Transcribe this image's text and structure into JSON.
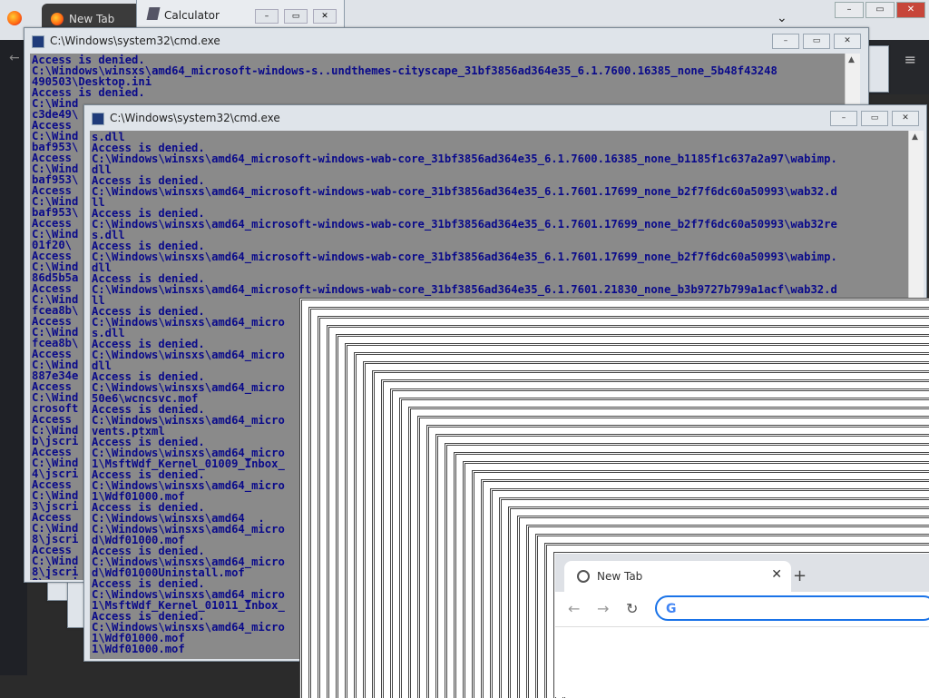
{
  "browser_bg": {
    "tab_label": "New Tab",
    "chevron": "⌄",
    "window_controls": [
      "–",
      "▭",
      "✕"
    ],
    "menu_icon": "≡"
  },
  "calculator": {
    "title": "Calculator",
    "controls": [
      "–",
      "▭",
      "✕"
    ]
  },
  "cmd_back": {
    "title": "C:\\Windows\\system32\\cmd.exe",
    "controls": [
      "–",
      "▭",
      "✕"
    ],
    "lines": [
      "Access is denied.",
      "C:\\Windows\\winsxs\\amd64_microsoft-windows-s..undthemes-cityscape_31bf3856ad364e35_6.1.7600.16385_none_5b48f43248",
      "490503\\Desktop.ini",
      "Access is denied.",
      "C:\\Wind",
      "c3de49\\",
      "Access",
      "C:\\Wind",
      "baf953\\",
      "Access",
      "C:\\Wind",
      "baf953\\",
      "Access",
      "C:\\Wind",
      "baf953\\",
      "Access",
      "C:\\Wind",
      "01f20\\",
      "Access",
      "C:\\Wind",
      "86d5b5a",
      "Access",
      "C:\\Wind",
      "fcea8b\\",
      "Access",
      "C:\\Wind",
      "fcea8b\\",
      "Access",
      "C:\\Wind",
      "887e34e",
      "Access",
      "C:\\Wind",
      "crosoft",
      "Access",
      "C:\\Wind",
      "b\\jscri",
      "Access",
      "C:\\Wind",
      "4\\jscri",
      "Access",
      "C:\\Wind",
      "3\\jscri",
      "Access",
      "C:\\Wind",
      "8\\jscri",
      "Access",
      "C:\\Wind",
      "8\\jscri",
      "8\\jscri"
    ]
  },
  "cmd_front": {
    "title": "C:\\Windows\\system32\\cmd.exe",
    "controls": [
      "–",
      "▭",
      "✕"
    ],
    "lines": [
      "s.dll",
      "Access is denied.",
      "C:\\Windows\\winsxs\\amd64_microsoft-windows-wab-core_31bf3856ad364e35_6.1.7600.16385_none_b1185f1c637a2a97\\wabimp.",
      "dll",
      "Access is denied.",
      "C:\\Windows\\winsxs\\amd64_microsoft-windows-wab-core_31bf3856ad364e35_6.1.7601.17699_none_b2f7f6dc60a50993\\wab32.d",
      "ll",
      "Access is denied.",
      "C:\\Windows\\winsxs\\amd64_microsoft-windows-wab-core_31bf3856ad364e35_6.1.7601.17699_none_b2f7f6dc60a50993\\wab32re",
      "s.dll",
      "Access is denied.",
      "C:\\Windows\\winsxs\\amd64_microsoft-windows-wab-core_31bf3856ad364e35_6.1.7601.17699_none_b2f7f6dc60a50993\\wabimp.",
      "dll",
      "Access is denied.",
      "C:\\Windows\\winsxs\\amd64_microsoft-windows-wab-core_31bf3856ad364e35_6.1.7601.21830_none_b3b9727b799a1acf\\wab32.d",
      "ll",
      "Access is denied.",
      "C:\\Windows\\winsxs\\amd64_micro",
      "s.dll",
      "Access is denied.",
      "C:\\Windows\\winsxs\\amd64_micro",
      "dll",
      "Access is denied.",
      "C:\\Windows\\winsxs\\amd64_micro",
      "50e6\\wcncsvc.mof",
      "Access is denied.",
      "C:\\Windows\\winsxs\\amd64_micro",
      "vents.ptxml",
      "Access is denied.",
      "C:\\Windows\\winsxs\\amd64_micro",
      "1\\MsftWdf_Kernel_01009_Inbox_",
      "Access is denied.",
      "C:\\Windows\\winsxs\\amd64_micro",
      "1\\Wdf01000.mof",
      "Access is denied.",
      "C:\\Windows\\winsxs\\amd64  .",
      "C:\\Windows\\winsxs\\amd64_micro",
      "d\\Wdf01000.mof",
      "Access is denied.",
      "C:\\Windows\\winsxs\\amd64_micro",
      "d\\Wdf01000Uninstall.mof",
      "Access is denied.",
      "C:\\Windows\\winsxs\\amd64_micro",
      "1\\MsftWdf_Kernel_01011_Inbox_",
      "Access is denied.",
      "C:\\Windows\\winsxs\\amd64_micro",
      "1\\Wdf01000.mof",
      "1\\Wdf01000.mof"
    ]
  },
  "chrome": {
    "tab_label": "New Tab",
    "close": "✕",
    "new_tab": "+",
    "back": "←",
    "forward": "→",
    "reload": "↻",
    "omnibox_logo": "G",
    "omnibox_value": ""
  }
}
